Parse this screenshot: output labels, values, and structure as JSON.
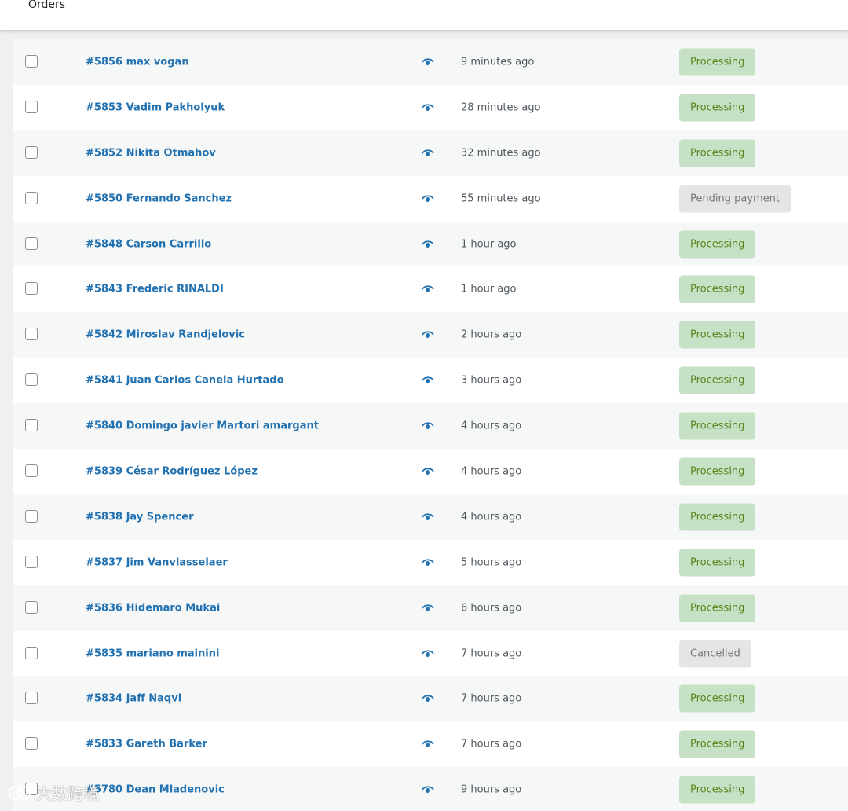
{
  "header": {
    "title": "Orders"
  },
  "orders": [
    {
      "label": "#5856 max vogan",
      "date": "9 minutes ago",
      "status": "Processing",
      "status_type": "processing"
    },
    {
      "label": "#5853 Vadim Pakholyuk",
      "date": "28 minutes ago",
      "status": "Processing",
      "status_type": "processing"
    },
    {
      "label": "#5852 Nikita Otmahov",
      "date": "32 minutes ago",
      "status": "Processing",
      "status_type": "processing"
    },
    {
      "label": "#5850 Fernando Sanchez",
      "date": "55 minutes ago",
      "status": "Pending payment",
      "status_type": "pending"
    },
    {
      "label": "#5848 Carson Carrillo",
      "date": "1 hour ago",
      "status": "Processing",
      "status_type": "processing"
    },
    {
      "label": "#5843 Frederic RINALDI",
      "date": "1 hour ago",
      "status": "Processing",
      "status_type": "processing"
    },
    {
      "label": "#5842 Miroslav Randjelovic",
      "date": "2 hours ago",
      "status": "Processing",
      "status_type": "processing"
    },
    {
      "label": "#5841 Juan Carlos Canela Hurtado",
      "date": "3 hours ago",
      "status": "Processing",
      "status_type": "processing"
    },
    {
      "label": "#5840 Domingo javier Martori amargant",
      "date": "4 hours ago",
      "status": "Processing",
      "status_type": "processing"
    },
    {
      "label": "#5839 César Rodríguez López",
      "date": "4 hours ago",
      "status": "Processing",
      "status_type": "processing"
    },
    {
      "label": "#5838 Jay Spencer",
      "date": "4 hours ago",
      "status": "Processing",
      "status_type": "processing"
    },
    {
      "label": "#5837 Jim Vanvlasselaer",
      "date": "5 hours ago",
      "status": "Processing",
      "status_type": "processing"
    },
    {
      "label": "#5836 Hidemaro Mukai",
      "date": "6 hours ago",
      "status": "Processing",
      "status_type": "processing"
    },
    {
      "label": "#5835 mariano mainini",
      "date": "7 hours ago",
      "status": "Cancelled",
      "status_type": "cancelled"
    },
    {
      "label": "#5834 Jaff Naqvi",
      "date": "7 hours ago",
      "status": "Processing",
      "status_type": "processing"
    },
    {
      "label": "#5833 Gareth Barker",
      "date": "7 hours ago",
      "status": "Processing",
      "status_type": "processing"
    },
    {
      "label": "#5780 Dean Mladenovic",
      "date": "9 hours ago",
      "status": "Processing",
      "status_type": "processing"
    }
  ],
  "icons": {
    "preview": "eye-icon"
  },
  "colors": {
    "link": "#2271b1",
    "processing_bg": "#c6e1c6",
    "processing_text": "#5b841b",
    "neutral_bg": "#e5e5e5",
    "neutral_text": "#777777"
  },
  "watermark": {
    "text": "大数跨境"
  }
}
